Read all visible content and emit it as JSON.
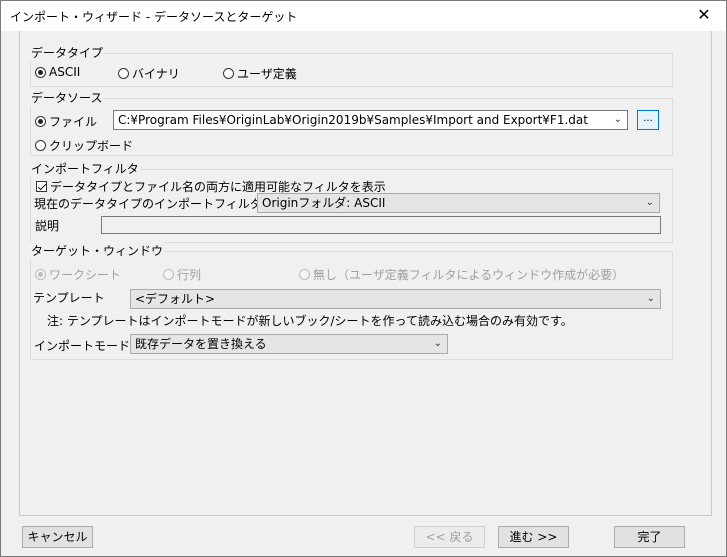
{
  "window": {
    "title": "インポート・ウィザード - データソースとターゲット",
    "close_glyph": "✕"
  },
  "data_type": {
    "label": "データタイプ",
    "options": [
      "ASCII",
      "バイナリ",
      "ユーザ定義"
    ],
    "selected": "ASCII"
  },
  "data_source": {
    "label": "データソース",
    "file_label": "ファイル",
    "clipboard_label": "クリップボード",
    "selected": "ファイル",
    "file_path": "C:¥Program Files¥OriginLab¥Origin2019b¥Samples¥Import and Export¥F1.dat",
    "browse_label": "..."
  },
  "import_filter": {
    "label": "インポートフィルタ",
    "show_applicable_label": "データタイプとファイル名の両方に適用可能なフィルタを表示",
    "show_applicable_checked": true,
    "current_filter_label": "現在のデータタイプのインポートフィルタ",
    "current_filter_value": "Originフォルダ: ASCII",
    "description_label": "説明",
    "description_value": ""
  },
  "target": {
    "label": "ターゲット・ウィンドウ",
    "options": [
      "ワークシート",
      "行列",
      "無し（ユーザ定義フィルタによるウィンドウ作成が必要）"
    ],
    "selected": "ワークシート",
    "template_label": "テンプレート",
    "template_value": "<デフォルト>",
    "note": "注: テンプレートはインポートモードが新しいブック/シートを作って読み込む場合のみ有効です。",
    "import_mode_label": "インポートモード",
    "import_mode_value": "既存データを置き換える"
  },
  "buttons": {
    "cancel": "キャンセル",
    "back": "<< 戻る",
    "next": "進む >>",
    "finish": "完了"
  },
  "icons": {
    "dropdown": "chevron-down-icon",
    "close": "close-icon"
  }
}
